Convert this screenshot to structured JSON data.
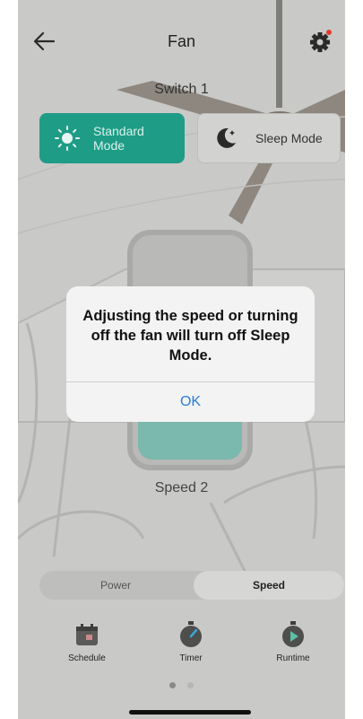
{
  "header": {
    "title": "Fan",
    "back_icon": "back-arrow-icon",
    "settings_icon": "gear-icon",
    "settings_badge_color": "#e23b2e"
  },
  "device": {
    "switch_name": "Switch 1"
  },
  "modes": {
    "standard": {
      "label": "Standard Mode",
      "icon": "sun-icon",
      "active": true,
      "color": "#1f9c86"
    },
    "sleep": {
      "label": "Sleep Mode",
      "icon": "moon-icon",
      "active": false
    }
  },
  "speed": {
    "label": "Speed 2"
  },
  "segmented": {
    "power_label": "Power",
    "speed_label": "Speed",
    "selected": "Speed"
  },
  "tools": {
    "schedule": {
      "label": "Schedule",
      "icon": "calendar-icon"
    },
    "timer": {
      "label": "Timer",
      "icon": "stopwatch-icon"
    },
    "runtime": {
      "label": "Runtime",
      "icon": "runtime-play-icon"
    }
  },
  "pager": {
    "pages": 2,
    "current": 1
  },
  "dialog": {
    "message": "Adjusting the speed or turning off the fan will turn off Sleep Mode.",
    "ok_label": "OK",
    "ok_color": "#2a7ed8"
  }
}
